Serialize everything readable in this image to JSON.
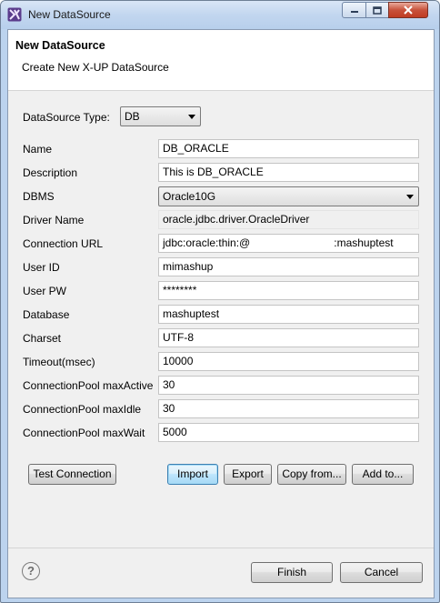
{
  "window": {
    "title": "New DataSource"
  },
  "header": {
    "title": "New DataSource",
    "subtitle": "Create New X-UP DataSource"
  },
  "datasource_type": {
    "label": "DataSource Type:",
    "value": "DB"
  },
  "form": {
    "name": {
      "label": "Name",
      "value": "DB_ORACLE"
    },
    "description": {
      "label": "Description",
      "value": "This is DB_ORACLE"
    },
    "dbms": {
      "label": "DBMS",
      "value": "Oracle10G"
    },
    "driver_name": {
      "label": "Driver Name",
      "value": "oracle.jdbc.driver.OracleDriver"
    },
    "connection_url": {
      "label": "Connection URL",
      "value_start": "jdbc:oracle:thin:@",
      "value_end": ":mashuptest"
    },
    "user_id": {
      "label": "User ID",
      "value": "mimashup"
    },
    "user_pw": {
      "label": "User PW",
      "value": "********"
    },
    "database": {
      "label": "Database",
      "value": "mashuptest"
    },
    "charset": {
      "label": "Charset",
      "value": "UTF-8"
    },
    "timeout": {
      "label": "Timeout(msec)",
      "value": "10000"
    },
    "pool_max_active": {
      "label": "ConnectionPool maxActive",
      "value": "30"
    },
    "pool_max_idle": {
      "label": "ConnectionPool maxIdle",
      "value": "30"
    },
    "pool_max_wait": {
      "label": "ConnectionPool maxWait",
      "value": "5000"
    }
  },
  "actions": {
    "test_connection": "Test Connection",
    "import": "Import",
    "export": "Export",
    "copy_from": "Copy from...",
    "add_to": "Add to..."
  },
  "footer": {
    "help_symbol": "?",
    "finish": "Finish",
    "cancel": "Cancel"
  }
}
